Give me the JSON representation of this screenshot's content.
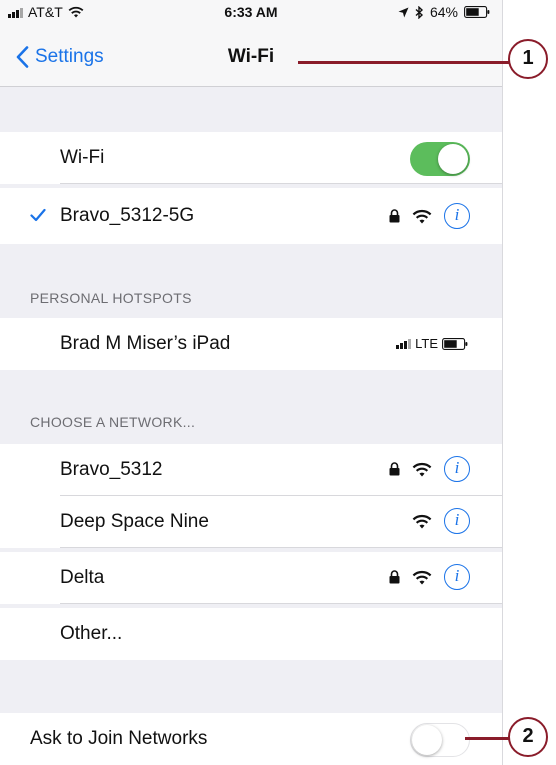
{
  "status_bar": {
    "carrier": "AT&T",
    "time": "6:33 AM",
    "battery": "64%"
  },
  "nav": {
    "back_label": "Settings",
    "title": "Wi-Fi"
  },
  "wifi_toggle": {
    "label": "Wi-Fi",
    "state": "on"
  },
  "connected": {
    "name": "Bravo_5312-5G",
    "secured": true
  },
  "hotspots": {
    "header": "PERSONAL HOTSPOTS",
    "items": [
      {
        "name": "Brad M Miser’s iPad",
        "network": "LTE"
      }
    ]
  },
  "networks": {
    "header": "CHOOSE A NETWORK...",
    "items": [
      {
        "name": "Bravo_5312",
        "secured": true
      },
      {
        "name": "Deep Space Nine",
        "secured": false
      },
      {
        "name": "Delta",
        "secured": true
      }
    ],
    "other_label": "Other..."
  },
  "ask_to_join": {
    "label": "Ask to Join Networks",
    "state": "off"
  },
  "callouts": [
    "1",
    "2"
  ],
  "colors": {
    "accent": "#1a73e8",
    "toggle_on": "#5cbd5c",
    "callout": "#8a1c2a"
  }
}
